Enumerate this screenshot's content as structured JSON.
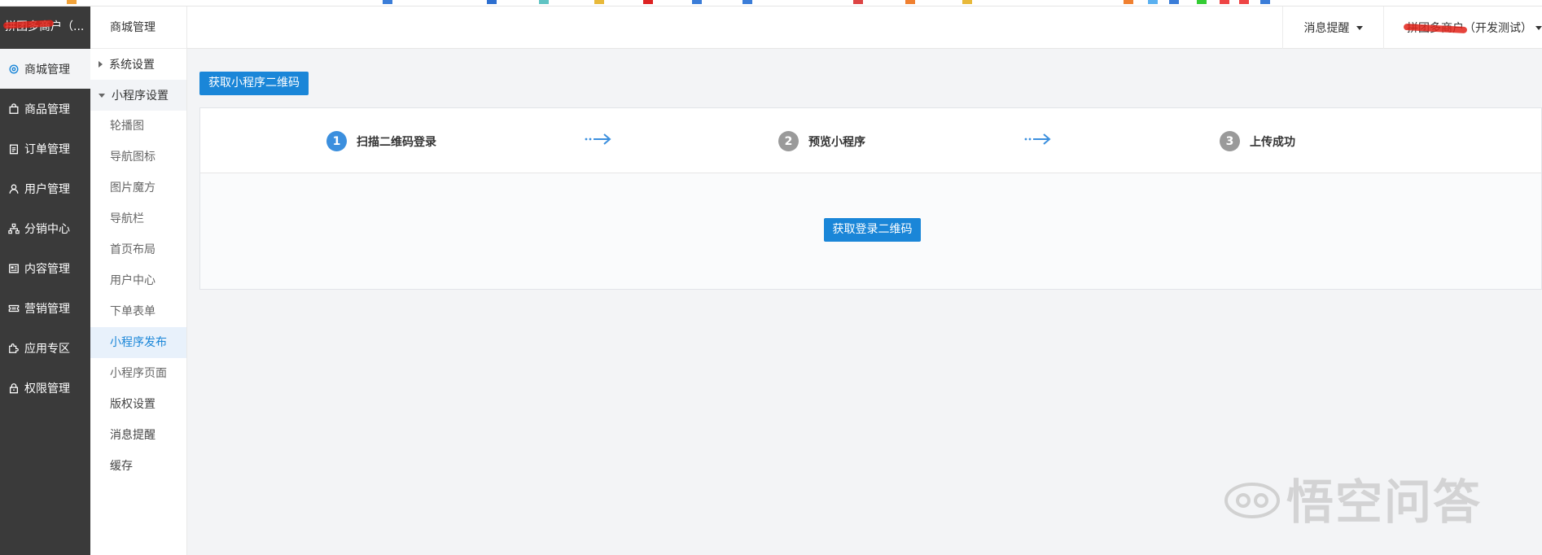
{
  "sidebar": {
    "brand": "拼团多商户（...",
    "items": [
      {
        "label": "商城管理",
        "icon": "gear-icon"
      },
      {
        "label": "商品管理",
        "icon": "bag-icon"
      },
      {
        "label": "订单管理",
        "icon": "clipboard-icon"
      },
      {
        "label": "用户管理",
        "icon": "user-icon"
      },
      {
        "label": "分销中心",
        "icon": "sitemap-icon"
      },
      {
        "label": "内容管理",
        "icon": "document-icon"
      },
      {
        "label": "营销管理",
        "icon": "ticket-icon"
      },
      {
        "label": "应用专区",
        "icon": "puzzle-icon"
      },
      {
        "label": "权限管理",
        "icon": "lock-icon"
      }
    ]
  },
  "subnav": {
    "title": "商城管理",
    "groups": [
      {
        "label": "系统设置"
      },
      {
        "label": "小程序设置"
      }
    ],
    "items": [
      {
        "label": "轮播图"
      },
      {
        "label": "导航图标"
      },
      {
        "label": "图片魔方"
      },
      {
        "label": "导航栏"
      },
      {
        "label": "首页布局"
      },
      {
        "label": "用户中心"
      },
      {
        "label": "下单表单"
      },
      {
        "label": "小程序发布"
      },
      {
        "label": "小程序页面"
      },
      {
        "label": "版权设置"
      },
      {
        "label": "消息提醒"
      },
      {
        "label": "缓存"
      }
    ]
  },
  "topbar": {
    "notifications": "消息提醒",
    "user": "拼团多商户（开发测试）"
  },
  "main": {
    "get_qr_button": "获取小程序二维码",
    "steps": [
      {
        "number": "1",
        "label": "扫描二维码登录"
      },
      {
        "number": "2",
        "label": "预览小程序"
      },
      {
        "number": "3",
        "label": "上传成功"
      }
    ],
    "login_qr_button": "获取登录二维码"
  },
  "watermark": "悟空问答",
  "colors": {
    "primary": "#1a86d8",
    "sidebar_bg": "#3a3a3a",
    "step_active": "#3b8fde",
    "step_inactive": "#9a9a9a",
    "redaction": "#e2231a"
  }
}
